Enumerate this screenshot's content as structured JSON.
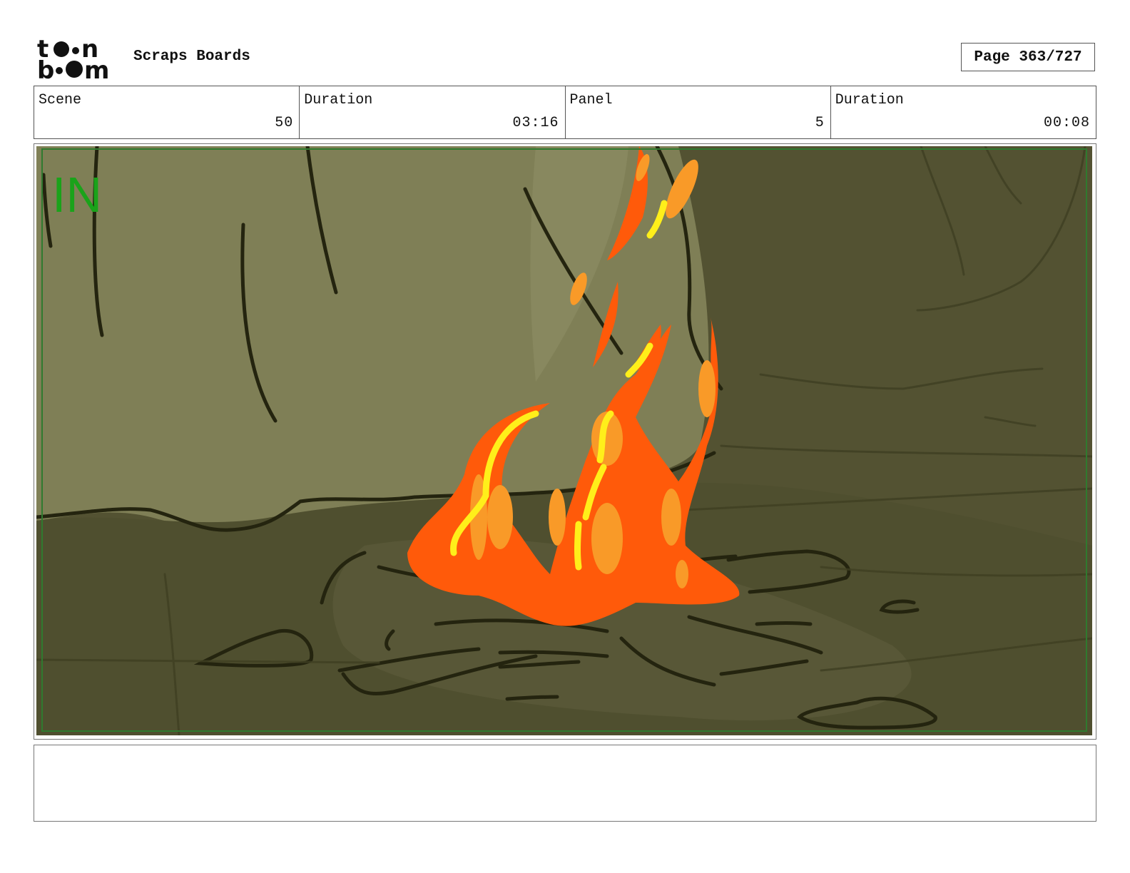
{
  "header": {
    "logo_text": "toon boom",
    "title": "Scraps Boards",
    "page_label": "Page 363/727"
  },
  "info": {
    "scene_label": "Scene",
    "scene_value": "50",
    "scene_duration_label": "Duration",
    "scene_duration_value": "03:16",
    "panel_label": "Panel",
    "panel_value": "5",
    "panel_duration_label": "Duration",
    "panel_duration_value": "00:08"
  },
  "panel": {
    "marker": "IN",
    "marker_color": "#1aa31a",
    "safe_frame_color": "#2f7a2f"
  },
  "notes": {
    "text": ""
  }
}
